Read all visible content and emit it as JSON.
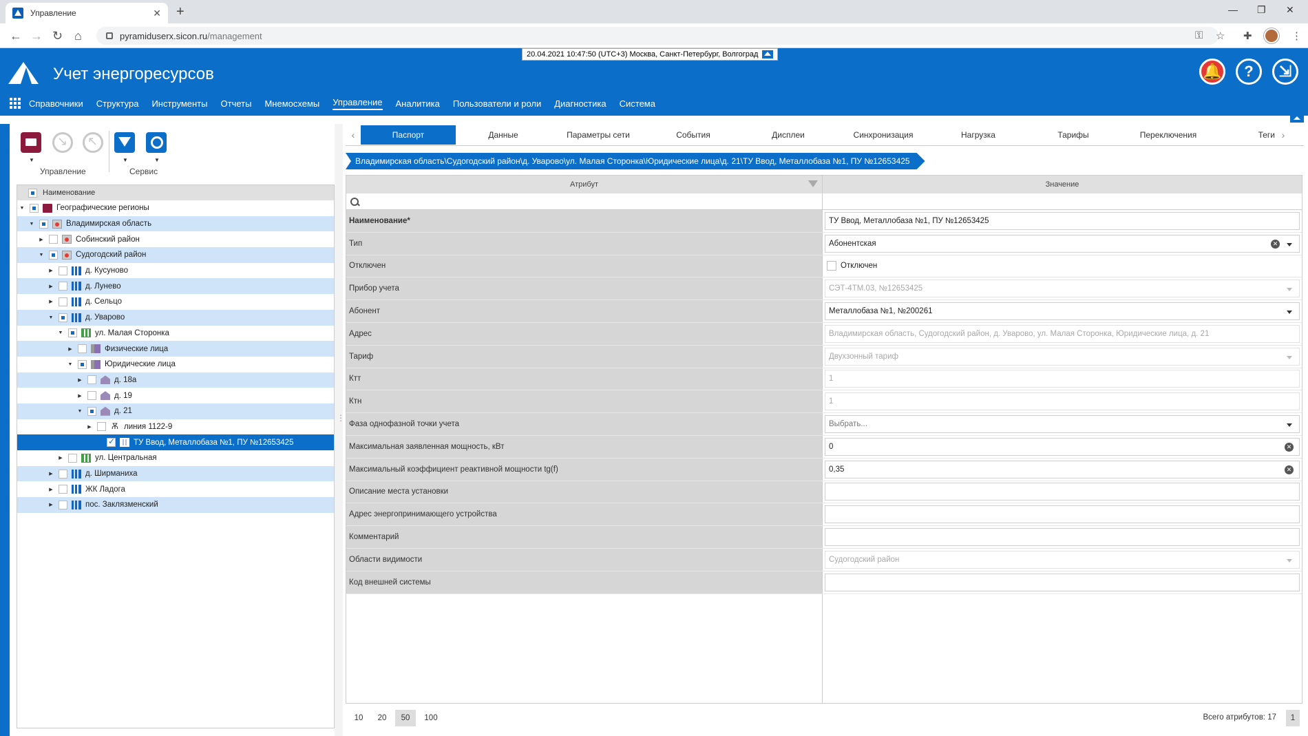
{
  "browser": {
    "tab_title": "Управление",
    "url_host": "pyramiduserx.sicon.ru",
    "url_path": "/management"
  },
  "header": {
    "app_title": "Учет энергоресурсов",
    "datetime": "20.04.2021 10:47:50 (UTC+3) Москва, Санкт-Петербург, Волгоград",
    "menu": [
      "Справочники",
      "Структура",
      "Инструменты",
      "Отчеты",
      "Мнемосхемы",
      "Управление",
      "Аналитика",
      "Пользователи и роли",
      "Диагностика",
      "Система"
    ],
    "active_menu": "Управление",
    "accent_color": "#0b6ec9"
  },
  "toolbar": {
    "group1_label": "Управление",
    "group2_label": "Сервис"
  },
  "tree": {
    "header": "Наименование",
    "nodes": [
      {
        "label": "Географические регионы",
        "level": 0,
        "icon": "folder-icon",
        "expanded": true,
        "check": "part",
        "alt": false
      },
      {
        "label": "Владимирская область",
        "level": 1,
        "icon": "region-icon",
        "expanded": true,
        "check": "part",
        "alt": true
      },
      {
        "label": "Собинский район",
        "level": 2,
        "icon": "region-icon",
        "expanded": false,
        "check": "none",
        "alt": false
      },
      {
        "label": "Судогодский район",
        "level": 2,
        "icon": "region-icon",
        "expanded": true,
        "check": "part",
        "alt": true
      },
      {
        "label": "д. Кусуново",
        "level": 3,
        "icon": "city-icon",
        "expanded": false,
        "check": "none",
        "alt": false
      },
      {
        "label": "д. Лунево",
        "level": 3,
        "icon": "city-icon",
        "expanded": false,
        "check": "none",
        "alt": true
      },
      {
        "label": "д. Сельцо",
        "level": 3,
        "icon": "city-icon",
        "expanded": false,
        "check": "none",
        "alt": false
      },
      {
        "label": "д. Уварово",
        "level": 3,
        "icon": "city-icon",
        "expanded": true,
        "check": "part",
        "alt": true
      },
      {
        "label": "ул. Малая Сторонка",
        "level": 4,
        "icon": "street-icon",
        "expanded": true,
        "check": "part",
        "alt": false
      },
      {
        "label": "Физические лица",
        "level": 5,
        "icon": "group-icon",
        "expanded": false,
        "check": "none",
        "alt": true
      },
      {
        "label": "Юридические лица",
        "level": 5,
        "icon": "group-icon",
        "expanded": true,
        "check": "part",
        "alt": false
      },
      {
        "label": "д. 18а",
        "level": 6,
        "icon": "house-icon",
        "expanded": false,
        "check": "none",
        "alt": true
      },
      {
        "label": "д. 19",
        "level": 6,
        "icon": "house-icon",
        "expanded": false,
        "check": "none",
        "alt": false
      },
      {
        "label": "д. 21",
        "level": 6,
        "icon": "house-icon",
        "expanded": true,
        "check": "part",
        "alt": true
      },
      {
        "label": "линия 1122-9",
        "level": 7,
        "icon": "line-icon",
        "expanded": false,
        "check": "none",
        "alt": false
      },
      {
        "label": "ТУ Ввод, Металлобаза №1, ПУ №12653425",
        "level": 8,
        "icon": "meter-icon",
        "expanded": null,
        "check": "chk",
        "alt": false,
        "selected": true
      },
      {
        "label": "ул. Центральная",
        "level": 4,
        "icon": "street-icon",
        "expanded": false,
        "check": "none",
        "alt": false
      },
      {
        "label": "д. Ширманиха",
        "level": 3,
        "icon": "city-icon",
        "expanded": false,
        "check": "none",
        "alt": true
      },
      {
        "label": "ЖК Ладога",
        "level": 3,
        "icon": "city-icon",
        "expanded": false,
        "check": "none",
        "alt": false
      },
      {
        "label": "пос. Заклязменский",
        "level": 3,
        "icon": "city-icon",
        "expanded": false,
        "check": "none",
        "alt": true
      }
    ]
  },
  "tabs": [
    "Паспорт",
    "Данные",
    "Параметры сети",
    "События",
    "Дисплеи",
    "Синхронизация",
    "Нагрузка",
    "Тарифы",
    "Переключения",
    "Теги"
  ],
  "active_tab": "Паспорт",
  "breadcrumb": "Владимирская область\\Судогодский район\\д. Уварово\\ул. Малая Сторонка\\Юридические лица\\д. 21\\ТУ Ввод, Металлобаза №1, ПУ №12653425",
  "grid": {
    "col_attr": "Атрибут",
    "col_value": "Значение",
    "rows": [
      {
        "attr": "Наименование*",
        "bold": true,
        "kind": "input",
        "value": "ТУ Ввод, Металлобаза №1, ПУ №12653425",
        "disabled": false
      },
      {
        "attr": "Тип",
        "kind": "select",
        "value": "Абонентская",
        "disabled": false,
        "clear": true
      },
      {
        "attr": "Отключен",
        "kind": "checkbox",
        "value": "Отключен"
      },
      {
        "attr": "Прибор учета",
        "kind": "select",
        "value": "СЭТ-4ТМ.03, №12653425",
        "disabled": true
      },
      {
        "attr": "Абонент",
        "kind": "select",
        "value": "Металлобаза №1, №200261",
        "disabled": false
      },
      {
        "attr": "Адрес",
        "kind": "input",
        "value": "Владимирская область, Судогодский район, д. Уварово, ул. Малая Сторонка, Юридические лица, д. 21",
        "disabled": true
      },
      {
        "attr": "Тариф",
        "kind": "select",
        "value": "Двухзонный тариф",
        "disabled": true
      },
      {
        "attr": "Ктт",
        "kind": "input",
        "value": "1",
        "disabled": true
      },
      {
        "attr": "Ктн",
        "kind": "input",
        "value": "1",
        "disabled": true
      },
      {
        "attr": "Фаза однофазной точки учета",
        "kind": "select",
        "value": "Выбрать...",
        "disabled": false,
        "muted": true
      },
      {
        "attr": "Максимальная заявленная мощность, кВт",
        "kind": "input",
        "value": "0",
        "disabled": false,
        "clear": true
      },
      {
        "attr": "Максимальный коэффициент реактивной мощности tg(f)",
        "kind": "input",
        "value": "0,35",
        "disabled": false,
        "clear": true
      },
      {
        "attr": "Описание места установки",
        "kind": "input",
        "value": "",
        "disabled": false
      },
      {
        "attr": "Адрес энергопринимающего устройства",
        "kind": "input",
        "value": "",
        "disabled": false
      },
      {
        "attr": "Комментарий",
        "kind": "input",
        "value": "",
        "disabled": false
      },
      {
        "attr": "Области видимости",
        "kind": "select",
        "value": "Судогодский район",
        "disabled": true
      },
      {
        "attr": "Код внешней системы",
        "kind": "input",
        "value": "",
        "disabled": false
      }
    ]
  },
  "pager": {
    "sizes": [
      "10",
      "20",
      "50",
      "100"
    ],
    "active_size": "50",
    "total": "Всего атрибутов: 17",
    "page": "1"
  }
}
